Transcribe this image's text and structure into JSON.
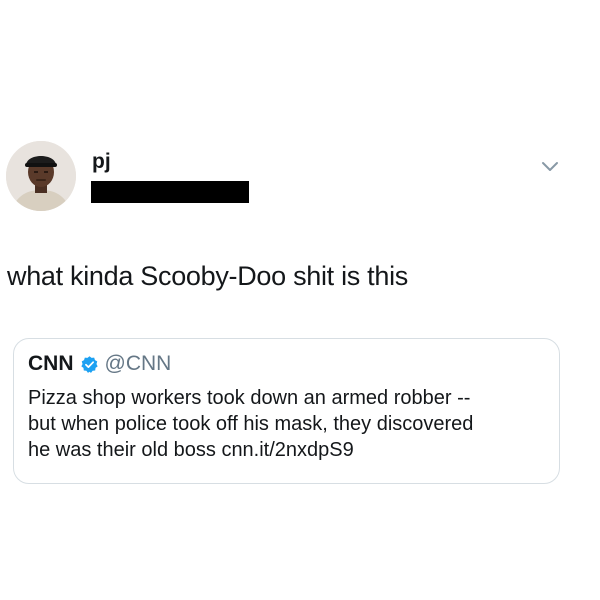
{
  "tweet": {
    "author": {
      "display_name": "pj",
      "handle": "",
      "avatar_icon": "profile-avatar-icon"
    },
    "menu_icon": "chevron-down-icon",
    "text": "what kinda Scooby-Doo shit is this",
    "quoted_tweet": {
      "author_name": "CNN",
      "verified": true,
      "verified_icon": "verified-badge-icon",
      "handle": "@CNN",
      "text_lines": [
        "Pizza shop workers took down an armed robber --",
        "but when police took off his mask, they discovered",
        "he was their old boss cnn.it/2nxdpS9"
      ]
    }
  },
  "colors": {
    "text_primary": "#14171a",
    "text_secondary": "#657786",
    "verified_blue": "#1da1f2",
    "card_border": "#d7dee3",
    "redaction": "#000000"
  }
}
